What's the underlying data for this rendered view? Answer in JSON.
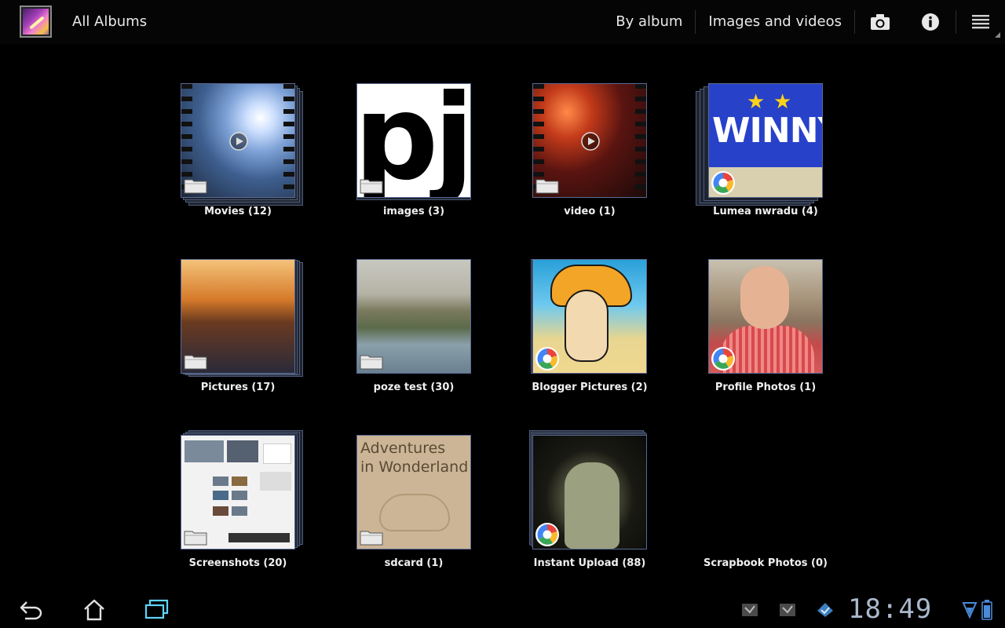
{
  "actionbar": {
    "title": "All Albums",
    "by_album": "By album",
    "filter": "Images and videos",
    "icons": {
      "app": "gallery-icon",
      "camera": "camera-icon",
      "info": "info-icon",
      "menu": "menu-icon"
    }
  },
  "albums": [
    {
      "label": "Movies (12)",
      "badge": "folder"
    },
    {
      "label": "images (3)",
      "badge": "folder"
    },
    {
      "label": "video (1)",
      "badge": "folder"
    },
    {
      "label": "Lumea nwradu (4)",
      "badge": "picasa"
    },
    {
      "label": "Pictures (17)",
      "badge": "folder"
    },
    {
      "label": "poze test (30)",
      "badge": "folder"
    },
    {
      "label": "Blogger Pictures (2)",
      "badge": "picasa"
    },
    {
      "label": "Profile Photos (1)",
      "badge": "picasa"
    },
    {
      "label": "Screenshots (20)",
      "badge": "folder"
    },
    {
      "label": "sdcard (1)",
      "badge": "folder"
    },
    {
      "label": "Instant Upload (88)",
      "badge": "picasa"
    },
    {
      "label": "Scrapbook Photos (0)",
      "badge": "none"
    }
  ],
  "thumb_text": {
    "images": "pj",
    "lumea": "WINNY",
    "sdcard_line1": "Adventures",
    "sdcard_line2": "in Wonderland"
  },
  "sysbar": {
    "clock": "18:49",
    "icons": {
      "back": "back-icon",
      "home": "home-icon",
      "recent": "recent-apps-icon"
    }
  }
}
